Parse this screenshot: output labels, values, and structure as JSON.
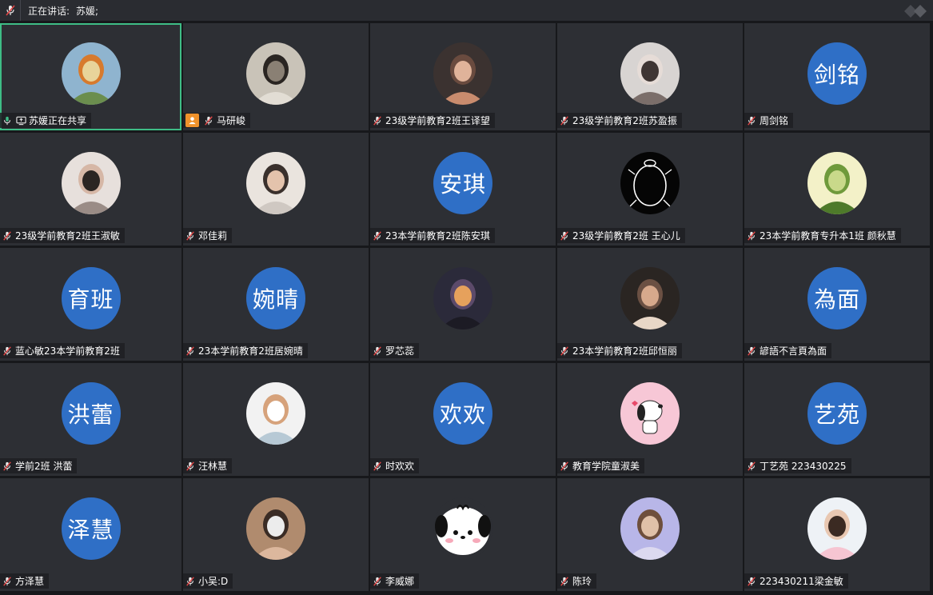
{
  "topbar": {
    "speaking_label": "正在讲话:",
    "speaker_name": "苏媛;"
  },
  "colors": {
    "tile_bg": "#2d2f34",
    "active_border": "#3ebd86",
    "text_avatar_bg": "#2f6fc6",
    "host_badge": "#f0922b"
  },
  "participants": [
    {
      "name": "苏媛正在共享",
      "avatar": "photo-painting-icon",
      "status": "sharing"
    },
    {
      "name": "马研峻",
      "avatar": "photo-statue-icon",
      "status": "muted-host"
    },
    {
      "name": "23级学前教育2班王译望",
      "avatar": "photo-child-icon",
      "status": "muted"
    },
    {
      "name": "23级学前教育2班苏盈振",
      "avatar": "photo-portrait-icon",
      "status": "muted"
    },
    {
      "name": "周剑铭",
      "avatar_text": "剑铭",
      "status": "muted"
    },
    {
      "name": "23级学前教育2班王淑敏",
      "avatar": "photo-girl-icon",
      "status": "muted"
    },
    {
      "name": "邓佳莉",
      "avatar": "photo-sleeping-icon",
      "status": "muted"
    },
    {
      "name": "23本学前教育2班陈安琪",
      "avatar_text": "安琪",
      "status": "muted"
    },
    {
      "name": "23级学前教育2班 王心儿",
      "avatar": "drawing-turtle-icon",
      "status": "muted"
    },
    {
      "name": "23本学前教育专升本1班 颜秋慧",
      "avatar": "photo-meadow-icon",
      "status": "muted"
    },
    {
      "name": "蓝心敏23本学前教育2班",
      "avatar_text": "育班",
      "status": "muted"
    },
    {
      "name": "23本学前教育2班居婉晴",
      "avatar_text": "婉晴",
      "status": "muted"
    },
    {
      "name": "罗芯蕊",
      "avatar": "photo-city-sunset-icon",
      "status": "muted"
    },
    {
      "name": "23本学前教育2班邱恒丽",
      "avatar": "photo-woman-icon",
      "status": "muted"
    },
    {
      "name": "諺語不言頁為面",
      "avatar_text": "為面",
      "status": "muted"
    },
    {
      "name": "学前2班  洪蕾",
      "avatar_text": "洪蕾",
      "status": "muted"
    },
    {
      "name": "汪林慧",
      "avatar": "photo-beach-icon",
      "status": "muted"
    },
    {
      "name": "时欢欢",
      "avatar_text": "欢欢",
      "status": "muted"
    },
    {
      "name": "教育学院童淑美",
      "avatar": "cartoon-snoopy-icon",
      "status": "muted"
    },
    {
      "name": "丁艺苑 223430225",
      "avatar_text": "艺苑",
      "status": "muted"
    },
    {
      "name": "方泽慧",
      "avatar_text": "泽慧",
      "status": "muted"
    },
    {
      "name": "小吴:D",
      "avatar": "photo-mask-girl-icon",
      "status": "muted"
    },
    {
      "name": "李威娜",
      "avatar": "cartoon-pochacco-icon",
      "status": "muted"
    },
    {
      "name": "陈玲",
      "avatar": "photo-hat-girl-icon",
      "status": "muted"
    },
    {
      "name": "223430211梁金敏",
      "avatar": "photo-little-girl-icon",
      "status": "muted"
    }
  ]
}
